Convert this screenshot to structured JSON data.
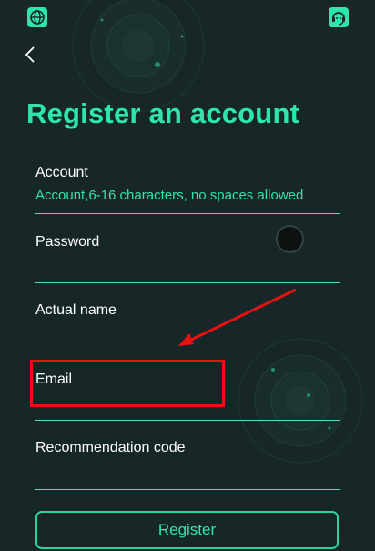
{
  "page": {
    "title": "Register an account"
  },
  "header": {
    "left_icon": "globe-icon",
    "right_icon": "headset-support-icon",
    "back_icon": "chevron-left-icon"
  },
  "form": {
    "account": {
      "label": "Account",
      "hint": "Account,6-16 characters, no spaces allowed"
    },
    "password": {
      "label": "Password"
    },
    "actual_name": {
      "label": "Actual name"
    },
    "email": {
      "label": "Email"
    },
    "recommendation_code": {
      "label": "Recommendation code"
    },
    "register_label": "Register"
  },
  "colors": {
    "background": "#172626",
    "accent": "#2ee5ab",
    "annotation": "#ea1111"
  }
}
